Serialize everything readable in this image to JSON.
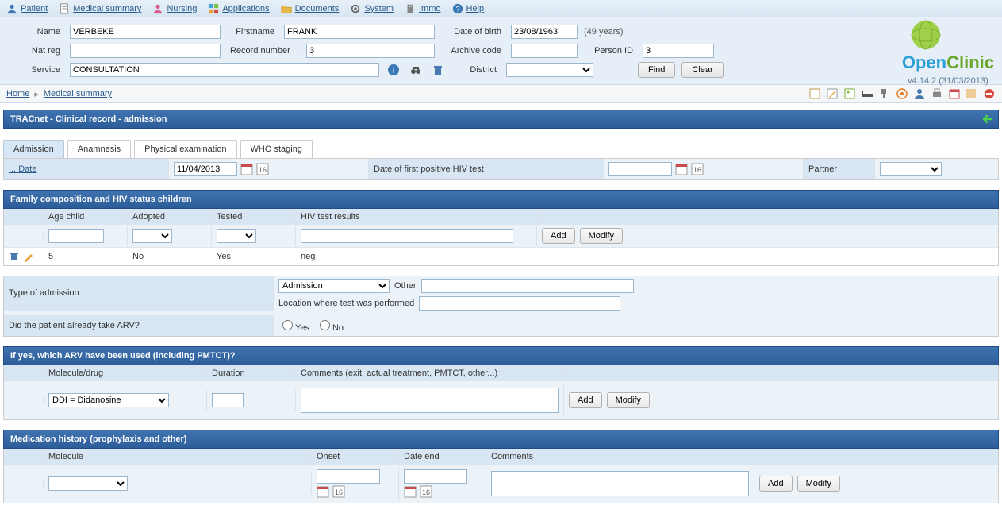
{
  "menu": {
    "patient": "Patient",
    "medical_summary": "Medical summary",
    "nursing": "Nursing",
    "applications": "Applications",
    "documents": "Documents",
    "system": "System",
    "immo": "Immo",
    "help": "Help"
  },
  "patient_header": {
    "labels": {
      "name": "Name",
      "firstname": "Firstname",
      "dob": "Date of birth",
      "nat_reg": "Nat reg",
      "record_number": "Record number",
      "archive_code": "Archive code",
      "person_id": "Person ID",
      "service": "Service",
      "district": "District"
    },
    "values": {
      "name": "VERBEKE",
      "firstname": "FRANK",
      "dob": "23/08/1963",
      "age": "(49 years)",
      "nat_reg": "",
      "record_number": "3",
      "archive_code": "",
      "person_id": "3",
      "service": "CONSULTATION",
      "district": ""
    },
    "buttons": {
      "find": "Find",
      "clear": "Clear"
    }
  },
  "branding": {
    "version": "v4.14.2 (31/03/2013)"
  },
  "breadcrumb": {
    "home": "Home",
    "medical_summary": "Medical summary"
  },
  "record": {
    "title": "TRACnet - Clinical record - admission",
    "tabs": {
      "admission": "Admission",
      "anamnesis": "Anamnesis",
      "physical": "Physical examination",
      "who": "WHO staging"
    },
    "row1": {
      "date_lbl": "... Date",
      "date_val": "11/04/2013",
      "first_hiv_lbl": "Date of first positive HIV test",
      "first_hiv_val": "",
      "partner_lbl": "Partner",
      "partner_val": ""
    },
    "family": {
      "title": "Family composition and HIV status children",
      "headers": {
        "age": "Age child",
        "adopted": "Adopted",
        "tested": "Tested",
        "results": "HIV test results"
      },
      "buttons": {
        "add": "Add",
        "modify": "Modify"
      },
      "rows": [
        {
          "age": "5",
          "adopted": "No",
          "tested": "Yes",
          "results": "neg"
        }
      ]
    },
    "admission_type": {
      "label": "Type of admission",
      "select": "Admission",
      "other_lbl": "Other",
      "other_val": "",
      "location_lbl": "Location where test was performed",
      "location_val": ""
    },
    "arv_q": {
      "label": "Did the patient already take ARV?",
      "yes": "Yes",
      "no": "No"
    },
    "arv_used": {
      "title": "If yes, which ARV have been used (including PMTCT)?",
      "headers": {
        "molecule": "Molecule/drug",
        "duration": "Duration",
        "comments": "Comments (exit, actual treatment, PMTCT, other...)"
      },
      "select": "DDI = Didanosine",
      "buttons": {
        "add": "Add",
        "modify": "Modify"
      }
    },
    "med_history": {
      "title": "Medication history (prophylaxis and other)",
      "headers": {
        "molecule": "Molecule",
        "onset": "Onset",
        "end": "Date end",
        "comments": "Comments"
      },
      "buttons": {
        "add": "Add",
        "modify": "Modify"
      }
    }
  }
}
